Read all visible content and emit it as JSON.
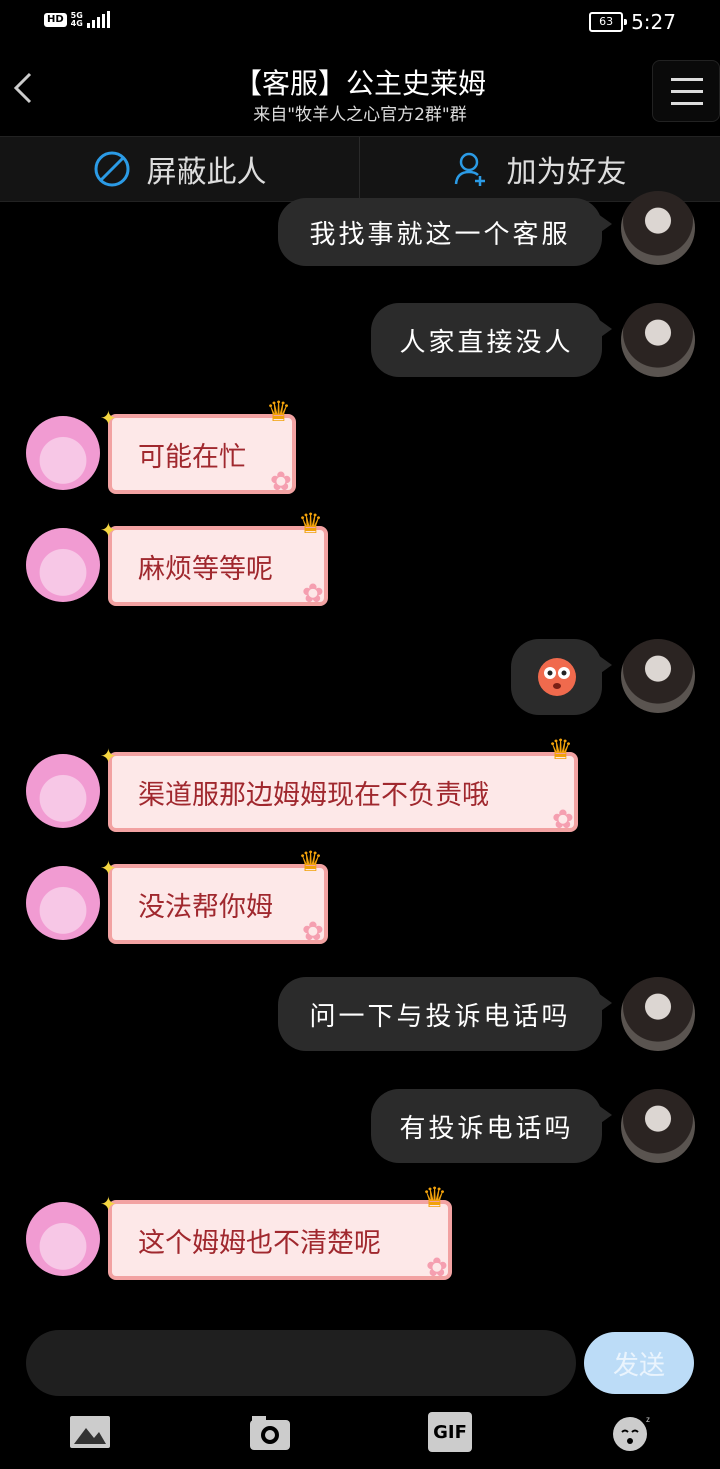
{
  "status_bar": {
    "hd": "HD",
    "network": "5G",
    "signal_sub": "4G",
    "battery": "63",
    "time": "5:27"
  },
  "header": {
    "title": "【客服】公主史莱姆",
    "subtitle": "来自\"牧羊人之心官方2群\"群"
  },
  "actions": {
    "block": "屏蔽此人",
    "add_friend": "加为好友"
  },
  "messages": [
    {
      "side": "me",
      "text": "我找事就这一个客服"
    },
    {
      "side": "me",
      "text": "人家直接没人"
    },
    {
      "side": "bot",
      "text": "可能在忙"
    },
    {
      "side": "bot",
      "text": "麻烦等等呢"
    },
    {
      "side": "me",
      "text": "",
      "emoji": "surprised-face"
    },
    {
      "side": "bot",
      "text": "渠道服那边姆姆现在不负责哦"
    },
    {
      "side": "bot",
      "text": "没法帮你姆"
    },
    {
      "side": "me",
      "text": "问一下与投诉电话吗"
    },
    {
      "side": "me",
      "text": "有投诉电话吗"
    },
    {
      "side": "bot",
      "text": "这个姆姆也不清楚呢"
    }
  ],
  "input": {
    "placeholder": "",
    "send_label": "发送"
  },
  "toolbar": {
    "gif_label": "GIF"
  },
  "colors": {
    "bubble_dark": "#2b2b2b",
    "bubble_pink_fill": "#fde8e8",
    "bubble_pink_border": "#f2a2a2",
    "bubble_pink_text": "#a0282e",
    "send_button": "#bcdcf7"
  }
}
